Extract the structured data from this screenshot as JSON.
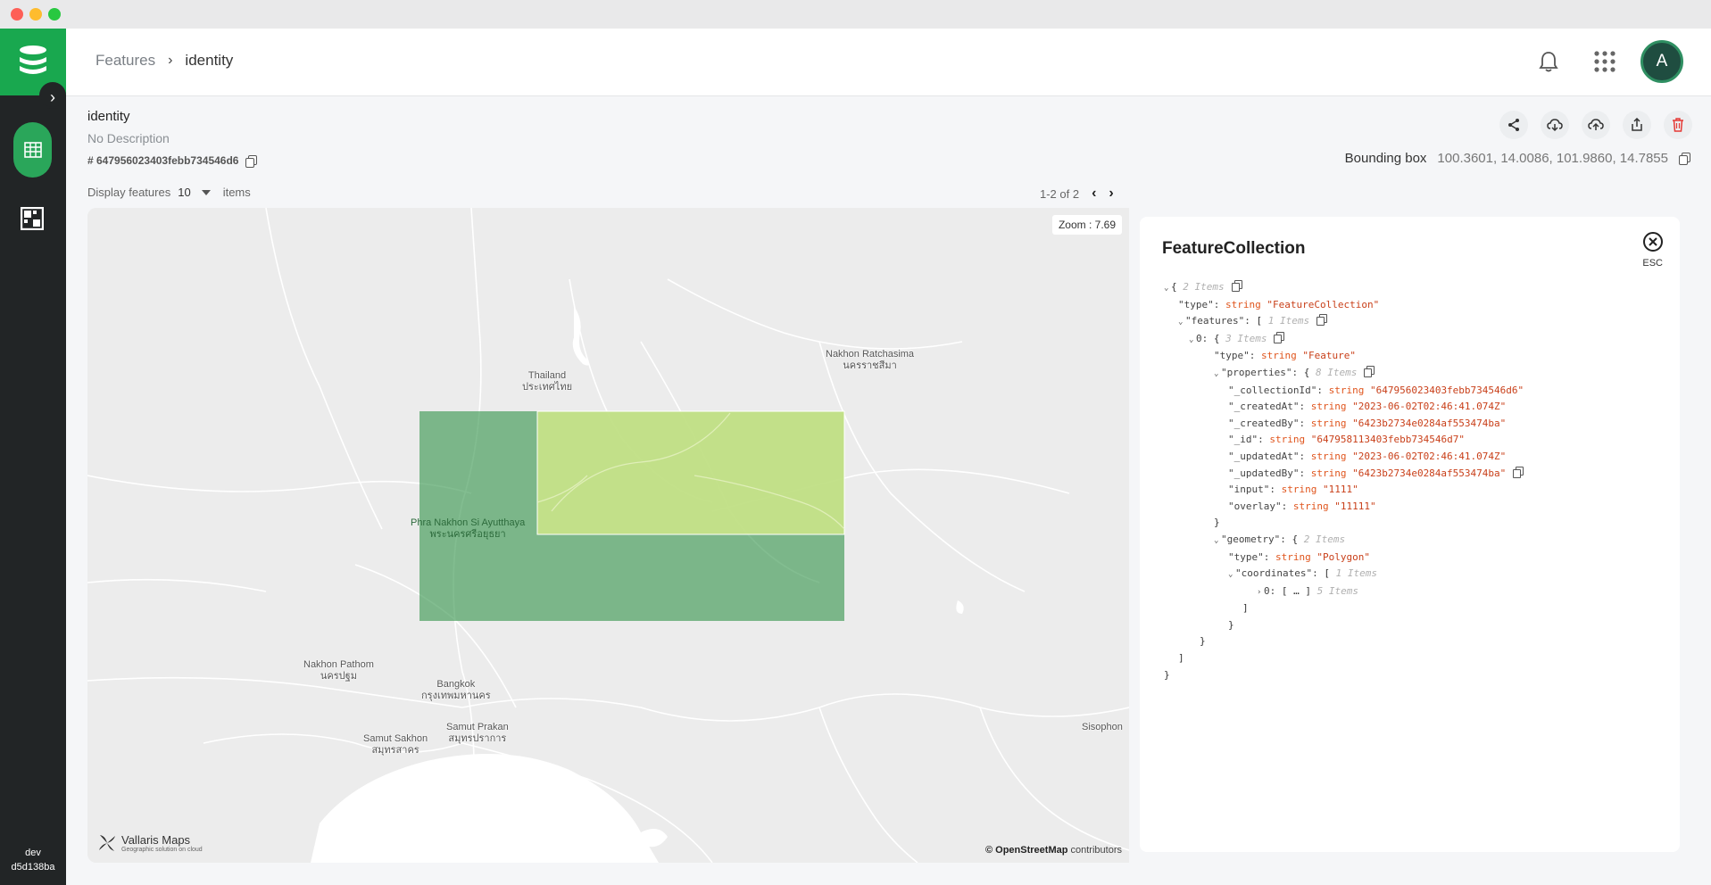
{
  "sidebar": {
    "user_env": "dev",
    "user_id": "d5d138ba"
  },
  "header": {
    "breadcrumb_parent": "Features",
    "breadcrumb_current": "identity",
    "avatar_initial": "A"
  },
  "layer": {
    "title": "identity",
    "description": "No Description",
    "id": "# 647956023403febb734546d6"
  },
  "bounding_box": {
    "label": "Bounding box",
    "value": "100.3601, 14.0086, 101.9860, 14.7855"
  },
  "display": {
    "label": "Display features",
    "count": "10",
    "suffix": "items"
  },
  "pager": {
    "range": "1-2 of 2"
  },
  "map": {
    "zoom": "Zoom : 7.69",
    "logo_name": "Vallaris Maps",
    "logo_sub": "Geographic solution on cloud",
    "attribution_brand": "© OpenStreetMap",
    "attribution_suffix": "contributors",
    "places": {
      "thailand": "Thailand",
      "thailand_th": "ประเทศไทย",
      "nakhon_ratchasima": "Nakhon Ratchasima",
      "nakhon_ratchasima_th": "นครราชสีมา",
      "ayutthaya": "Phra Nakhon Si Ayutthaya",
      "ayutthaya_th": "พระนครศรีอยุธยา",
      "nakhon_pathom": "Nakhon Pathom",
      "nakhon_pathom_th": "นครปฐม",
      "bangkok": "Bangkok",
      "bangkok_th": "กรุงเทพมหานคร",
      "samut_sakhon": "Samut Sakhon",
      "samut_sakhon_th": "สมุทรสาคร",
      "samut_prakan": "Samut Prakan",
      "samut_prakan_th": "สมุทรปราการ",
      "sisophon": "Sisophon"
    },
    "colors": {
      "polygon_dark": "#3f9a55",
      "polygon_light": "#c6e27a"
    }
  },
  "panel": {
    "title": "FeatureCollection",
    "esc": "ESC",
    "json": {
      "root_meta": "2 Items",
      "type_key": "\"type\":",
      "type_type": "string",
      "type_val": "\"FeatureCollection\"",
      "features_key": "\"features\":",
      "features_meta": "1 Items",
      "f0_key": "0:",
      "f0_meta": "3 Items",
      "f0_type_key": "\"type\":",
      "f0_type_val": "\"Feature\"",
      "props_key": "\"properties\":",
      "props_meta": "8 Items",
      "p_collectionId_key": "\"_collectionId\":",
      "p_collectionId_val": "\"647956023403febb734546d6\"",
      "p_createdAt_key": "\"_createdAt\":",
      "p_createdAt_val": "\"2023-06-02T02:46:41.074Z\"",
      "p_createdBy_key": "\"_createdBy\":",
      "p_createdBy_val": "\"6423b2734e0284af553474ba\"",
      "p_id_key": "\"_id\":",
      "p_id_val": "\"647958113403febb734546d7\"",
      "p_updatedAt_key": "\"_updatedAt\":",
      "p_updatedAt_val": "\"2023-06-02T02:46:41.074Z\"",
      "p_updatedBy_key": "\"_updatedBy\":",
      "p_updatedBy_val": "\"6423b2734e0284af553474ba\"",
      "p_input_key": "\"input\":",
      "p_input_val": "\"1111\"",
      "p_overlay_key": "\"overlay\":",
      "p_overlay_val": "\"11111\"",
      "geom_key": "\"geometry\":",
      "geom_meta": "2 Items",
      "g_type_key": "\"type\":",
      "g_type_val": "\"Polygon\"",
      "coords_key": "\"coordinates\":",
      "coords_meta": "1 Items",
      "c0_key": "0:",
      "c0_val": "[ … ]",
      "c0_meta": "5 Items",
      "string_type": "string"
    }
  }
}
